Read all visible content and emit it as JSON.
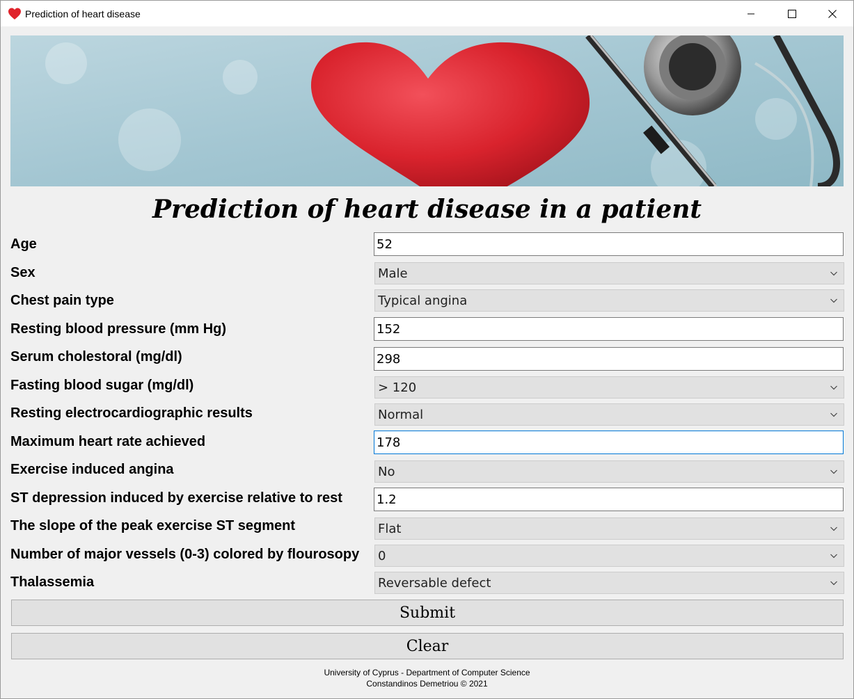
{
  "window": {
    "title": "Prediction of heart disease"
  },
  "heading": "Prediction of heart disease in a patient",
  "fields": {
    "age": {
      "label": "Age",
      "value": "52"
    },
    "sex": {
      "label": "Sex",
      "value": "Male"
    },
    "chest_pain": {
      "label": "Chest pain type",
      "value": "Typical angina"
    },
    "resting_bp": {
      "label": "Resting blood pressure (mm Hg)",
      "value": "152"
    },
    "cholesterol": {
      "label": "Serum cholestoral (mg/dl)",
      "value": "298"
    },
    "fbs": {
      "label": "Fasting blood sugar (mg/dl)",
      "value": "> 120"
    },
    "ecg": {
      "label": "Resting electrocardiographic results",
      "value": "Normal"
    },
    "max_hr": {
      "label": "Maximum heart rate achieved",
      "value": "178"
    },
    "angina": {
      "label": "Exercise induced angina",
      "value": "No"
    },
    "st_depression": {
      "label": "ST depression induced by exercise relative to rest",
      "value": "1.2"
    },
    "slope": {
      "label": "The slope of the peak exercise ST segment",
      "value": "Flat"
    },
    "vessels": {
      "label": "Number of major vessels (0-3) colored by flourosopy",
      "value": "0"
    },
    "thal": {
      "label": "Thalassemia",
      "value": "Reversable defect"
    }
  },
  "buttons": {
    "submit": "Submit",
    "clear": "Clear"
  },
  "footer": {
    "line1": "University of Cyprus - Department of Computer Science",
    "line2": "Constandinos Demetriou © 2021"
  },
  "icons": {
    "app": "heart-icon",
    "minimize": "minimize-icon",
    "maximize": "maximize-icon",
    "close": "close-icon",
    "dropdown": "chevron-down-icon"
  },
  "colors": {
    "heart": "#e0232b",
    "focus_border": "#0078d7",
    "banner_bg": "#a9c8d3"
  }
}
